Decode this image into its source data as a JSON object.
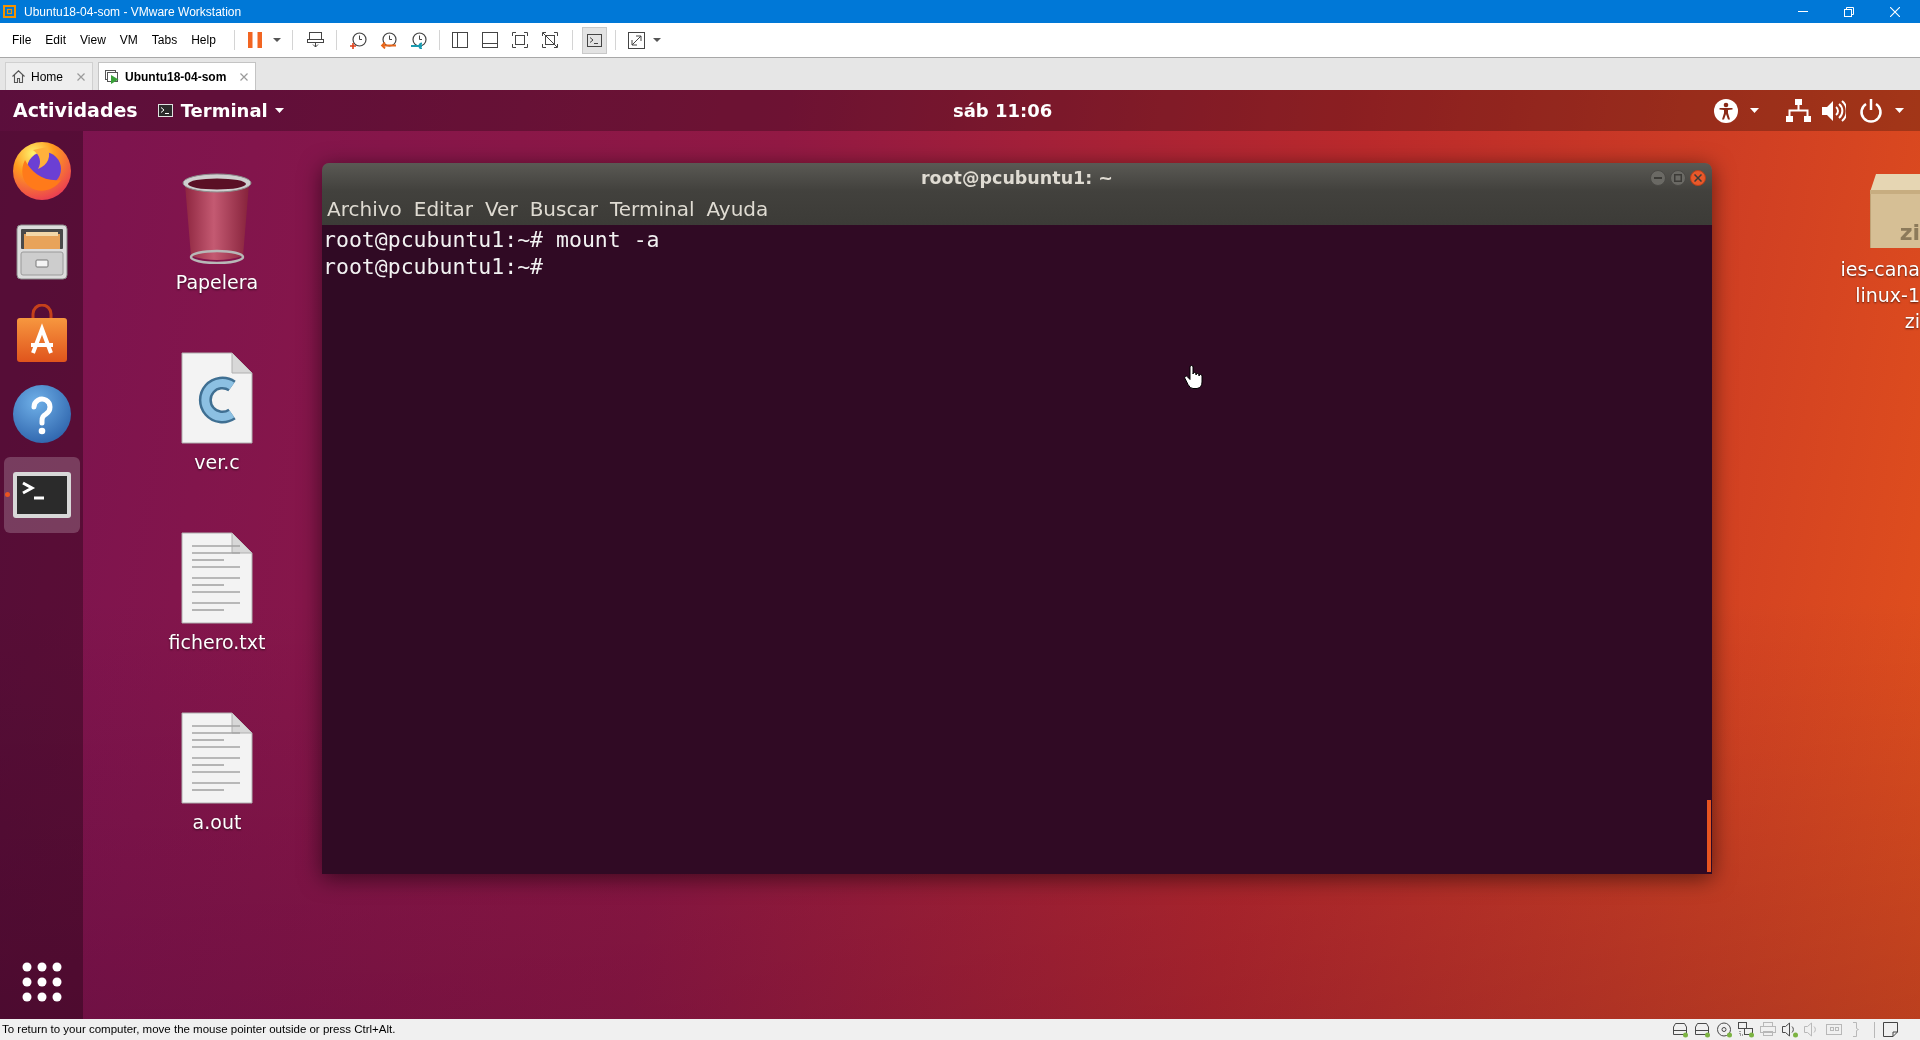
{
  "window": {
    "title": "Ubuntu18-04-som - VMware Workstation"
  },
  "menu_bar": [
    "File",
    "Edit",
    "View",
    "VM",
    "Tabs",
    "Help"
  ],
  "toolbar": {
    "console_button": {
      "selected": true
    }
  },
  "tabs": [
    {
      "kind": "home",
      "label": "Home",
      "selected": false
    },
    {
      "kind": "vm",
      "label": "Ubuntu18-04-som",
      "selected": true
    }
  ],
  "guest": {
    "top_bar": {
      "activities": "Actividades",
      "app_menu": "Terminal",
      "clock": "sáb 11:06"
    },
    "dock": [
      {
        "kind": "browser",
        "running": false,
        "selected": false
      },
      {
        "kind": "files",
        "running": false,
        "selected": false
      },
      {
        "kind": "software",
        "running": false,
        "selected": false
      },
      {
        "kind": "help",
        "running": false,
        "selected": false
      },
      {
        "kind": "terminal",
        "running": true,
        "selected": true
      }
    ],
    "desktop_icons": [
      {
        "kind": "trash",
        "label": "Papelera"
      },
      {
        "kind": "c-source",
        "label": "ver.c"
      },
      {
        "kind": "text",
        "label": "fichero.txt"
      },
      {
        "kind": "text",
        "label": "a.out"
      }
    ],
    "archive_icon": {
      "badge": "zi",
      "label_lines": [
        "ies-cana",
        "linux-1",
        "zi"
      ]
    },
    "terminal": {
      "title": "root@pcubuntu1: ~",
      "menu": [
        "Archivo",
        "Editar",
        "Ver",
        "Buscar",
        "Terminal",
        "Ayuda"
      ],
      "lines": [
        "root@pcubuntu1:~# mount -a",
        "root@pcubuntu1:~#"
      ]
    }
  },
  "status_bar": {
    "message": "To return to your computer, move the mouse pointer outside or press Ctrl+Alt.",
    "devices": [
      {
        "kind": "disk",
        "connected": true
      },
      {
        "kind": "disk",
        "connected": true
      },
      {
        "kind": "cd",
        "connected": true
      },
      {
        "kind": "network",
        "connected": true
      },
      {
        "kind": "printer",
        "connected": false
      },
      {
        "kind": "sound",
        "connected": true
      },
      {
        "kind": "sound",
        "connected": false
      },
      {
        "kind": "usb",
        "connected": false
      },
      {
        "kind": "serial",
        "connected": false
      }
    ]
  }
}
